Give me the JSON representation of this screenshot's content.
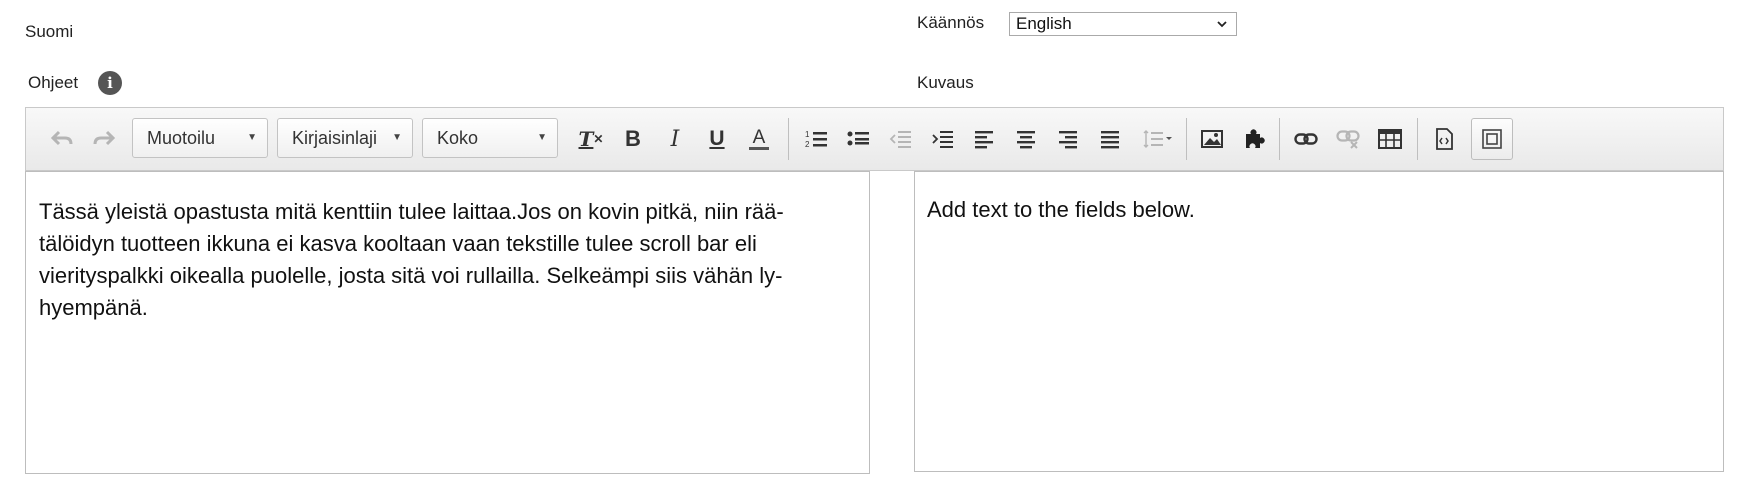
{
  "labels": {
    "source_language": "Suomi",
    "instructions": "Ohjeet",
    "translation": "Käännös",
    "description": "Kuvaus"
  },
  "translation_select": {
    "value": "English"
  },
  "toolbar": {
    "format_combo": "Muotoilu",
    "font_combo": "Kirjaisinlaji",
    "size_combo": "Koko"
  },
  "icons": {
    "info": "info-icon",
    "undo": "undo-icon",
    "redo": "redo-icon",
    "remove_format": "remove-format-icon",
    "bold": "bold-icon",
    "italic": "italic-icon",
    "underline": "underline-icon",
    "text_color": "text-color-icon",
    "numbered_list": "numbered-list-icon",
    "bulleted_list": "bulleted-list-icon",
    "outdent": "outdent-icon",
    "indent": "indent-icon",
    "align_left": "align-left-icon",
    "align_center": "align-center-icon",
    "align_right": "align-right-icon",
    "justify": "justify-icon",
    "line_height": "line-height-icon",
    "image": "image-icon",
    "plugin": "puzzle-icon",
    "link": "link-icon",
    "unlink": "unlink-icon",
    "table": "table-icon",
    "source": "source-icon",
    "show_blocks": "show-blocks-icon"
  },
  "editors": {
    "left_text": "Tässä yleistä opastusta mitä kenttiin tulee laittaa.Jos on kovin pitkä, niin rää-tälöidyn tuotteen ikkuna ei kasva kooltaan vaan tekstille tulee scroll bar eli vierityspalkki oikealla puolelle, josta sitä voi rullailla. Selkeämpi siis vähän ly-hyempänä.",
    "right_text": "Add text to the fields below."
  }
}
